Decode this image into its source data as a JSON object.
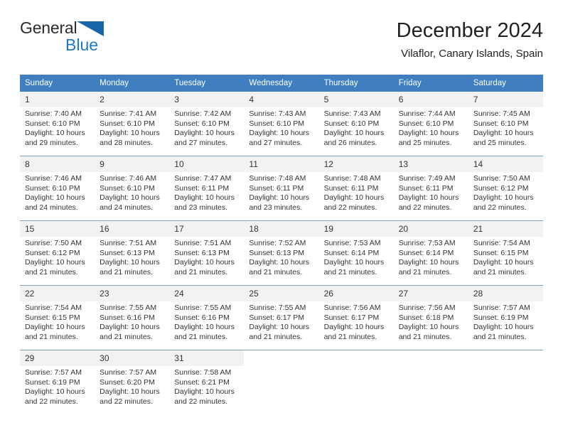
{
  "brand": {
    "name_part1": "General",
    "name_part2": "Blue",
    "logo_icon": "triangle-logo-icon",
    "color_primary": "#2079c7",
    "color_text": "#2b2b2b"
  },
  "header": {
    "title": "December 2024",
    "subtitle": "Vilaflor, Canary Islands, Spain"
  },
  "colors": {
    "header_row_bg": "#3f7fbf",
    "daynum_bg": "#f2f2f2",
    "row_divider": "#7e9fc0",
    "text": "#333333"
  },
  "weekdays": [
    {
      "label": "Sunday"
    },
    {
      "label": "Monday"
    },
    {
      "label": "Tuesday"
    },
    {
      "label": "Wednesday"
    },
    {
      "label": "Thursday"
    },
    {
      "label": "Friday"
    },
    {
      "label": "Saturday"
    }
  ],
  "weeks": [
    {
      "days": [
        {
          "num": "1",
          "sunrise": "Sunrise: 7:40 AM",
          "sunset": "Sunset: 6:10 PM",
          "daylight1": "Daylight: 10 hours",
          "daylight2": "and 29 minutes."
        },
        {
          "num": "2",
          "sunrise": "Sunrise: 7:41 AM",
          "sunset": "Sunset: 6:10 PM",
          "daylight1": "Daylight: 10 hours",
          "daylight2": "and 28 minutes."
        },
        {
          "num": "3",
          "sunrise": "Sunrise: 7:42 AM",
          "sunset": "Sunset: 6:10 PM",
          "daylight1": "Daylight: 10 hours",
          "daylight2": "and 27 minutes."
        },
        {
          "num": "4",
          "sunrise": "Sunrise: 7:43 AM",
          "sunset": "Sunset: 6:10 PM",
          "daylight1": "Daylight: 10 hours",
          "daylight2": "and 27 minutes."
        },
        {
          "num": "5",
          "sunrise": "Sunrise: 7:43 AM",
          "sunset": "Sunset: 6:10 PM",
          "daylight1": "Daylight: 10 hours",
          "daylight2": "and 26 minutes."
        },
        {
          "num": "6",
          "sunrise": "Sunrise: 7:44 AM",
          "sunset": "Sunset: 6:10 PM",
          "daylight1": "Daylight: 10 hours",
          "daylight2": "and 25 minutes."
        },
        {
          "num": "7",
          "sunrise": "Sunrise: 7:45 AM",
          "sunset": "Sunset: 6:10 PM",
          "daylight1": "Daylight: 10 hours",
          "daylight2": "and 25 minutes."
        }
      ]
    },
    {
      "days": [
        {
          "num": "8",
          "sunrise": "Sunrise: 7:46 AM",
          "sunset": "Sunset: 6:10 PM",
          "daylight1": "Daylight: 10 hours",
          "daylight2": "and 24 minutes."
        },
        {
          "num": "9",
          "sunrise": "Sunrise: 7:46 AM",
          "sunset": "Sunset: 6:10 PM",
          "daylight1": "Daylight: 10 hours",
          "daylight2": "and 24 minutes."
        },
        {
          "num": "10",
          "sunrise": "Sunrise: 7:47 AM",
          "sunset": "Sunset: 6:11 PM",
          "daylight1": "Daylight: 10 hours",
          "daylight2": "and 23 minutes."
        },
        {
          "num": "11",
          "sunrise": "Sunrise: 7:48 AM",
          "sunset": "Sunset: 6:11 PM",
          "daylight1": "Daylight: 10 hours",
          "daylight2": "and 23 minutes."
        },
        {
          "num": "12",
          "sunrise": "Sunrise: 7:48 AM",
          "sunset": "Sunset: 6:11 PM",
          "daylight1": "Daylight: 10 hours",
          "daylight2": "and 22 minutes."
        },
        {
          "num": "13",
          "sunrise": "Sunrise: 7:49 AM",
          "sunset": "Sunset: 6:11 PM",
          "daylight1": "Daylight: 10 hours",
          "daylight2": "and 22 minutes."
        },
        {
          "num": "14",
          "sunrise": "Sunrise: 7:50 AM",
          "sunset": "Sunset: 6:12 PM",
          "daylight1": "Daylight: 10 hours",
          "daylight2": "and 22 minutes."
        }
      ]
    },
    {
      "days": [
        {
          "num": "15",
          "sunrise": "Sunrise: 7:50 AM",
          "sunset": "Sunset: 6:12 PM",
          "daylight1": "Daylight: 10 hours",
          "daylight2": "and 21 minutes."
        },
        {
          "num": "16",
          "sunrise": "Sunrise: 7:51 AM",
          "sunset": "Sunset: 6:13 PM",
          "daylight1": "Daylight: 10 hours",
          "daylight2": "and 21 minutes."
        },
        {
          "num": "17",
          "sunrise": "Sunrise: 7:51 AM",
          "sunset": "Sunset: 6:13 PM",
          "daylight1": "Daylight: 10 hours",
          "daylight2": "and 21 minutes."
        },
        {
          "num": "18",
          "sunrise": "Sunrise: 7:52 AM",
          "sunset": "Sunset: 6:13 PM",
          "daylight1": "Daylight: 10 hours",
          "daylight2": "and 21 minutes."
        },
        {
          "num": "19",
          "sunrise": "Sunrise: 7:53 AM",
          "sunset": "Sunset: 6:14 PM",
          "daylight1": "Daylight: 10 hours",
          "daylight2": "and 21 minutes."
        },
        {
          "num": "20",
          "sunrise": "Sunrise: 7:53 AM",
          "sunset": "Sunset: 6:14 PM",
          "daylight1": "Daylight: 10 hours",
          "daylight2": "and 21 minutes."
        },
        {
          "num": "21",
          "sunrise": "Sunrise: 7:54 AM",
          "sunset": "Sunset: 6:15 PM",
          "daylight1": "Daylight: 10 hours",
          "daylight2": "and 21 minutes."
        }
      ]
    },
    {
      "days": [
        {
          "num": "22",
          "sunrise": "Sunrise: 7:54 AM",
          "sunset": "Sunset: 6:15 PM",
          "daylight1": "Daylight: 10 hours",
          "daylight2": "and 21 minutes."
        },
        {
          "num": "23",
          "sunrise": "Sunrise: 7:55 AM",
          "sunset": "Sunset: 6:16 PM",
          "daylight1": "Daylight: 10 hours",
          "daylight2": "and 21 minutes."
        },
        {
          "num": "24",
          "sunrise": "Sunrise: 7:55 AM",
          "sunset": "Sunset: 6:16 PM",
          "daylight1": "Daylight: 10 hours",
          "daylight2": "and 21 minutes."
        },
        {
          "num": "25",
          "sunrise": "Sunrise: 7:55 AM",
          "sunset": "Sunset: 6:17 PM",
          "daylight1": "Daylight: 10 hours",
          "daylight2": "and 21 minutes."
        },
        {
          "num": "26",
          "sunrise": "Sunrise: 7:56 AM",
          "sunset": "Sunset: 6:17 PM",
          "daylight1": "Daylight: 10 hours",
          "daylight2": "and 21 minutes."
        },
        {
          "num": "27",
          "sunrise": "Sunrise: 7:56 AM",
          "sunset": "Sunset: 6:18 PM",
          "daylight1": "Daylight: 10 hours",
          "daylight2": "and 21 minutes."
        },
        {
          "num": "28",
          "sunrise": "Sunrise: 7:57 AM",
          "sunset": "Sunset: 6:19 PM",
          "daylight1": "Daylight: 10 hours",
          "daylight2": "and 21 minutes."
        }
      ]
    },
    {
      "days": [
        {
          "num": "29",
          "sunrise": "Sunrise: 7:57 AM",
          "sunset": "Sunset: 6:19 PM",
          "daylight1": "Daylight: 10 hours",
          "daylight2": "and 22 minutes."
        },
        {
          "num": "30",
          "sunrise": "Sunrise: 7:57 AM",
          "sunset": "Sunset: 6:20 PM",
          "daylight1": "Daylight: 10 hours",
          "daylight2": "and 22 minutes."
        },
        {
          "num": "31",
          "sunrise": "Sunrise: 7:58 AM",
          "sunset": "Sunset: 6:21 PM",
          "daylight1": "Daylight: 10 hours",
          "daylight2": "and 22 minutes."
        },
        {
          "num": "",
          "sunrise": "",
          "sunset": "",
          "daylight1": "",
          "daylight2": ""
        },
        {
          "num": "",
          "sunrise": "",
          "sunset": "",
          "daylight1": "",
          "daylight2": ""
        },
        {
          "num": "",
          "sunrise": "",
          "sunset": "",
          "daylight1": "",
          "daylight2": ""
        },
        {
          "num": "",
          "sunrise": "",
          "sunset": "",
          "daylight1": "",
          "daylight2": ""
        }
      ]
    }
  ]
}
